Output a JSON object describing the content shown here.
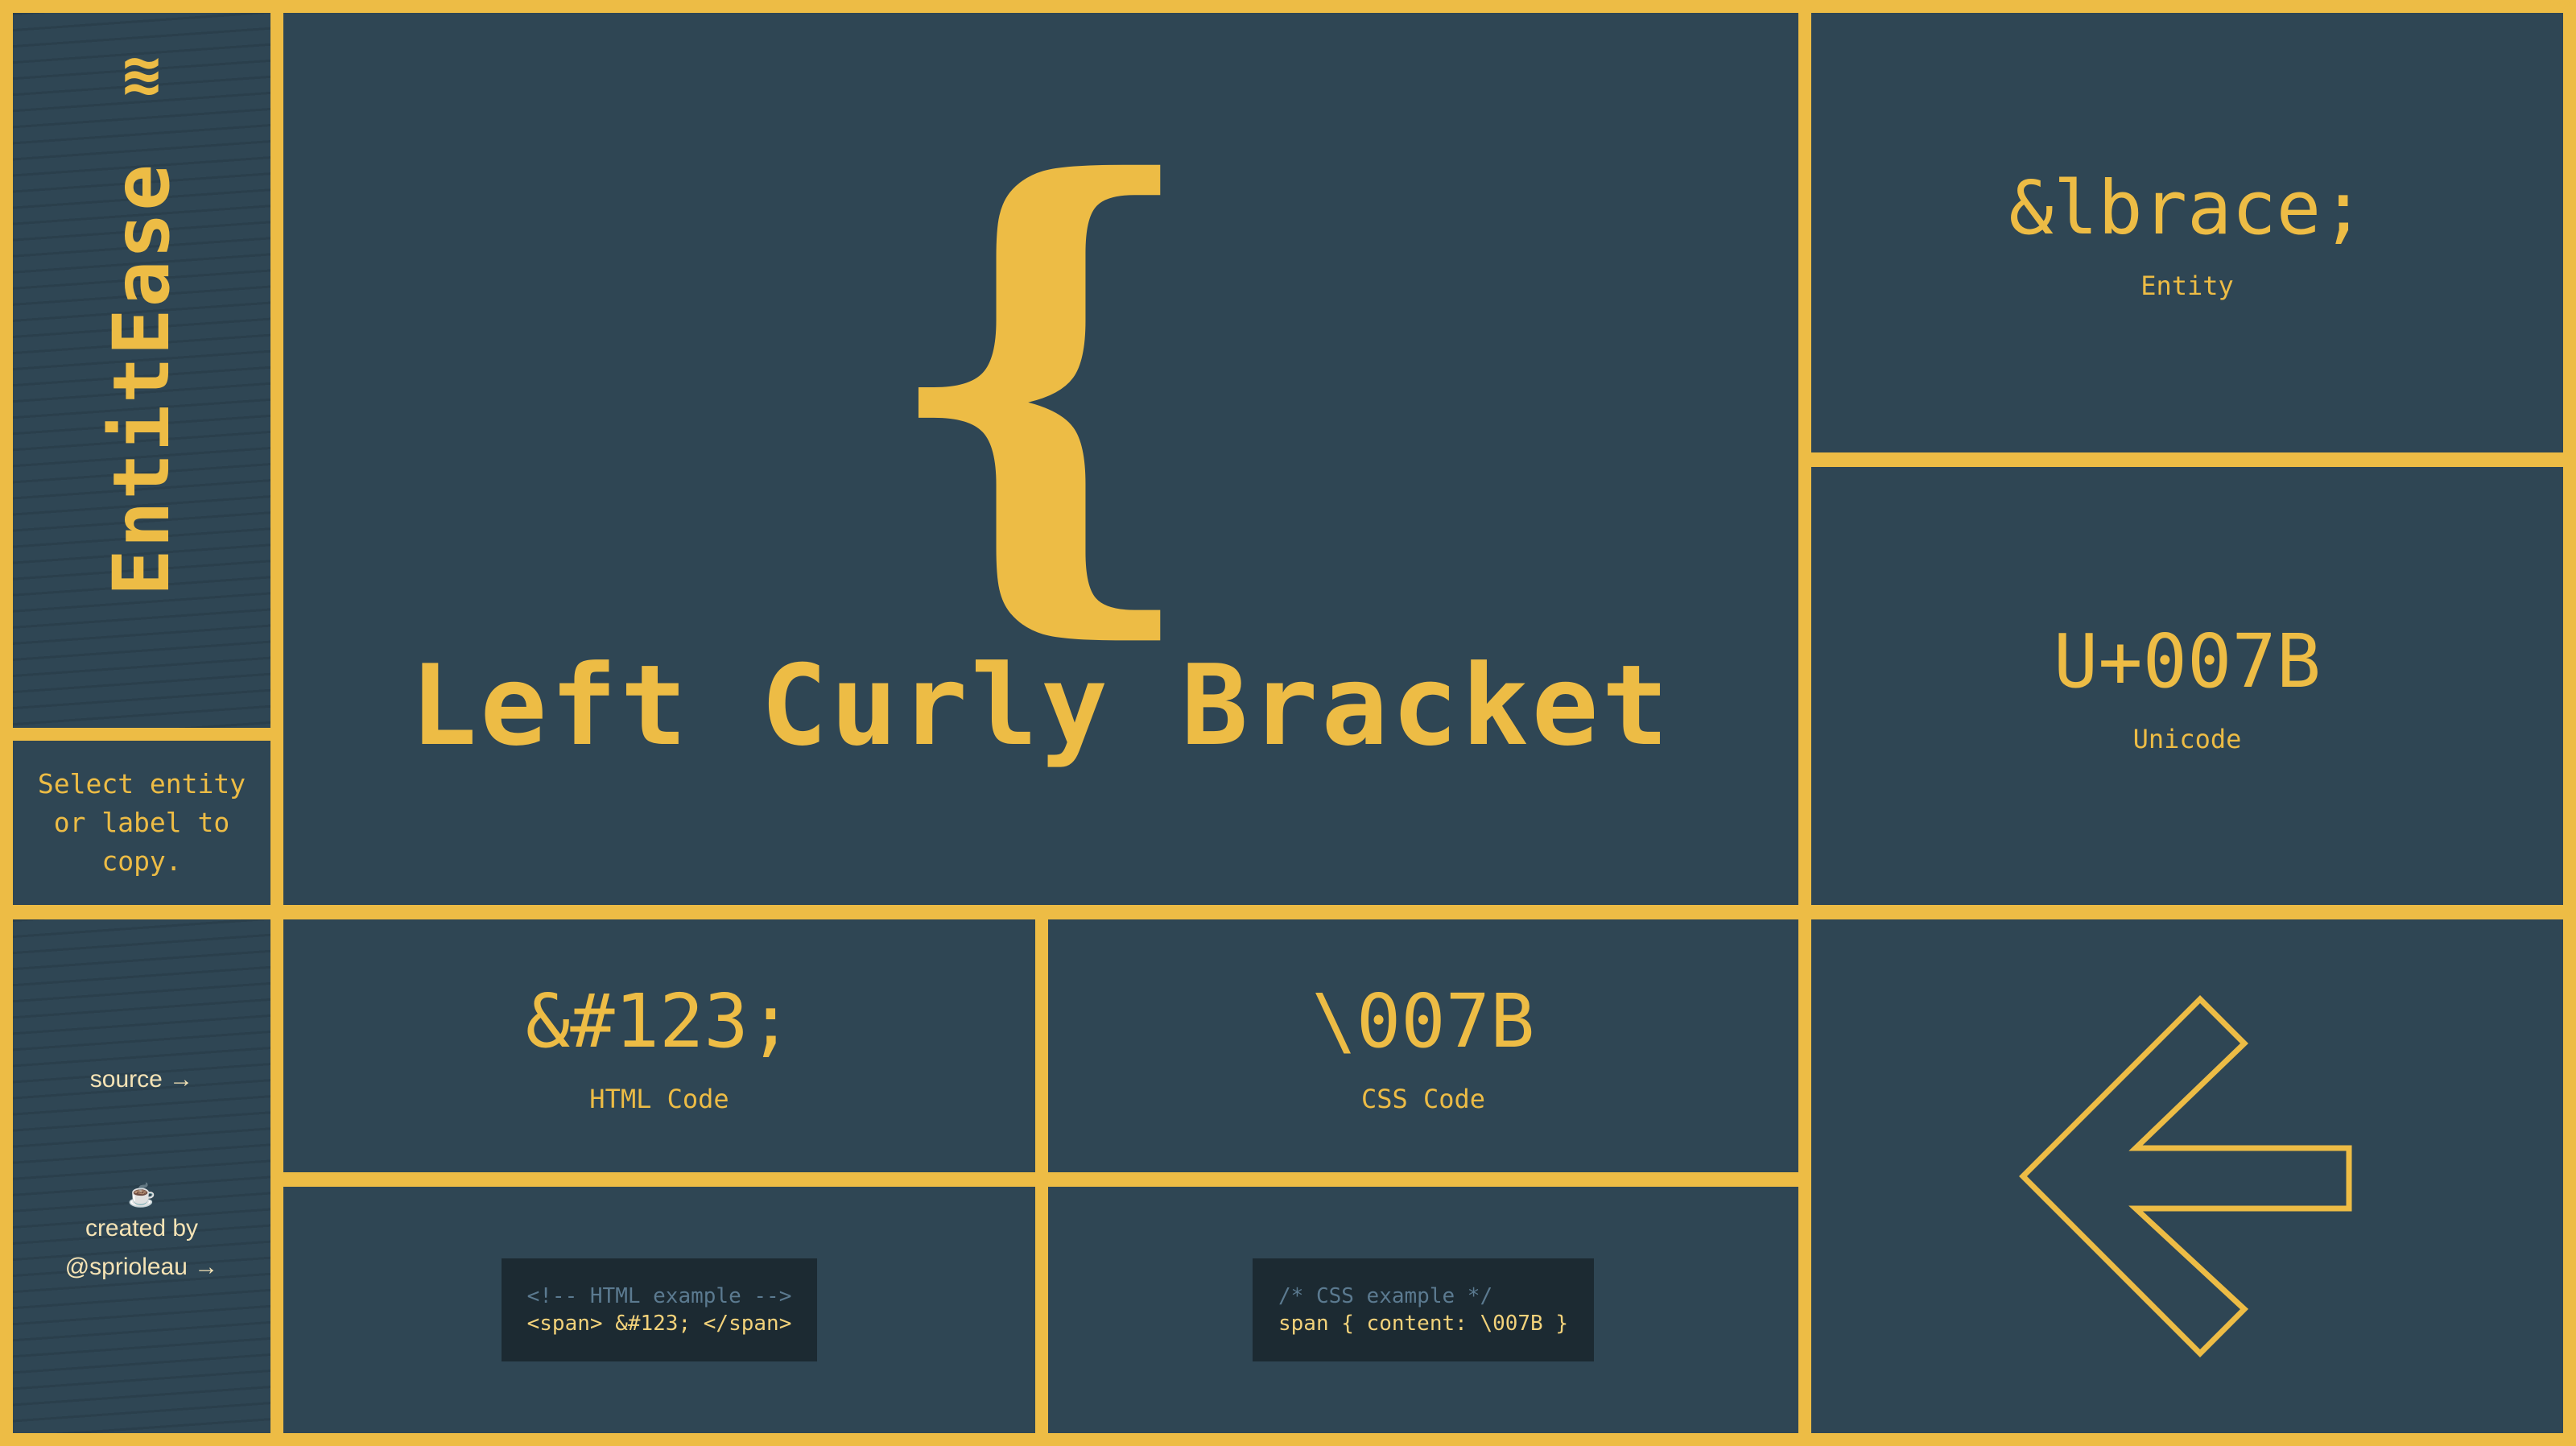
{
  "sidebar": {
    "logo_icon": "≋",
    "brand": "EntitEase",
    "hint": "Select entity or label to copy.",
    "source_link": "source →",
    "creator_icon": "☕",
    "created_by": "created by",
    "creator_handle": "@sprioleau →"
  },
  "main": {
    "glyph": "{",
    "name": "Left Curly Bracket"
  },
  "entity": {
    "value": "&lbrace;",
    "label": "Entity"
  },
  "unicode": {
    "value": "U+007B",
    "label": "Unicode"
  },
  "html_code": {
    "value": "&#123;",
    "label": "HTML Code"
  },
  "css_code": {
    "value": "\\007B",
    "label": "CSS Code"
  },
  "html_example": {
    "comment": "<!-- HTML example -->",
    "code": "<span> &#123; </span>"
  },
  "css_example": {
    "comment": "/* CSS example */",
    "code": "span { content: \\007B }"
  },
  "nav": {
    "icon": "arrow-left-icon"
  },
  "colors": {
    "accent": "#EDBC45",
    "panel": "#2F4654",
    "code_bg": "#1C2A32",
    "code_comment": "#5B7A90"
  }
}
